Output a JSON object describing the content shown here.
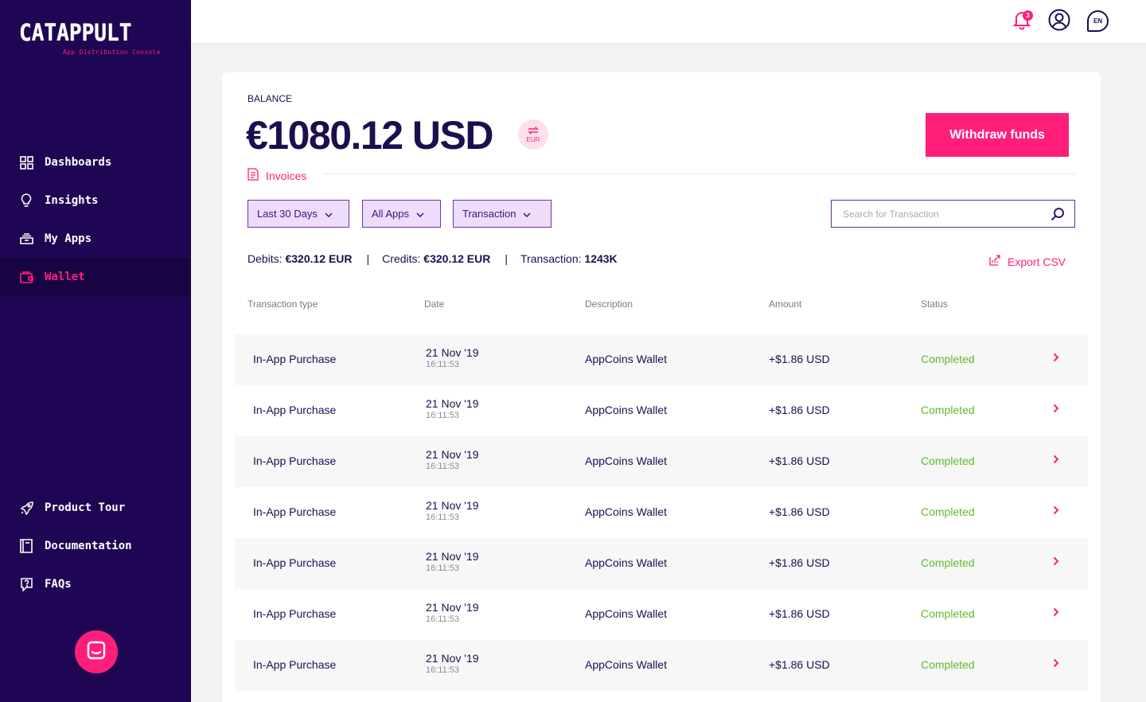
{
  "brand": {
    "name": "CATAPPULT",
    "subtitle": "App Distribution Console"
  },
  "sidebar": {
    "items": [
      {
        "label": "Dashboards",
        "icon": "grid-icon"
      },
      {
        "label": "Insights",
        "icon": "lightbulb-icon"
      },
      {
        "label": "My Apps",
        "icon": "apps-tray-icon"
      },
      {
        "label": "Wallet",
        "icon": "wallet-icon",
        "active": true
      }
    ],
    "bottom_items": [
      {
        "label": "Product Tour",
        "icon": "rocket-icon"
      },
      {
        "label": "Documentation",
        "icon": "book-icon"
      },
      {
        "label": "FAQs",
        "icon": "help-icon"
      }
    ]
  },
  "topbar": {
    "notification_count": "3",
    "language": "EN"
  },
  "balance": {
    "label": "BALANCE",
    "value": "€1080.12 USD",
    "switch_currency": "EUR",
    "withdraw_label": "Withdraw funds",
    "invoices_label": "Invoices"
  },
  "filters": {
    "period": "Last 30 Days",
    "apps": "All Apps",
    "type": "Transaction",
    "search_placeholder": "Search for Transaction"
  },
  "summary": {
    "debits_label": "Debits:",
    "debits_value": "€320.12 EUR",
    "credits_label": "Credits:",
    "credits_value": "€320.12 EUR",
    "transactions_label": "Transaction:",
    "transactions_value": "1243K",
    "export_label": "Export CSV"
  },
  "table": {
    "headers": [
      "Transaction type",
      "Date",
      "Description",
      "Amount",
      "Status"
    ],
    "rows": [
      {
        "type": "In-App Purchase",
        "date": "21 Nov '19",
        "time": "16:11:53",
        "description": "AppCoins Wallet",
        "amount": "+$1.86 USD",
        "status": "Completed"
      },
      {
        "type": "In-App Purchase",
        "date": "21 Nov '19",
        "time": "16:11:53",
        "description": "AppCoins Wallet",
        "amount": "+$1.86 USD",
        "status": "Completed"
      },
      {
        "type": "In-App Purchase",
        "date": "21 Nov '19",
        "time": "16:11:53",
        "description": "AppCoins Wallet",
        "amount": "+$1.86 USD",
        "status": "Completed"
      },
      {
        "type": "In-App Purchase",
        "date": "21 Nov '19",
        "time": "16:11:53",
        "description": "AppCoins Wallet",
        "amount": "+$1.86 USD",
        "status": "Completed"
      },
      {
        "type": "In-App Purchase",
        "date": "21 Nov '19",
        "time": "16:11:53",
        "description": "AppCoins Wallet",
        "amount": "+$1.86 USD",
        "status": "Completed"
      },
      {
        "type": "In-App Purchase",
        "date": "21 Nov '19",
        "time": "16:11:53",
        "description": "AppCoins Wallet",
        "amount": "+$1.86 USD",
        "status": "Completed"
      },
      {
        "type": "In-App Purchase",
        "date": "21 Nov '19",
        "time": "16:11:53",
        "description": "AppCoins Wallet",
        "amount": "+$1.86 USD",
        "status": "Completed"
      }
    ]
  },
  "colors": {
    "sidebar_bg": "#1e0654",
    "accent": "#ff1f7b",
    "completed": "#64b82b",
    "text_dark": "#1d0e4f"
  }
}
